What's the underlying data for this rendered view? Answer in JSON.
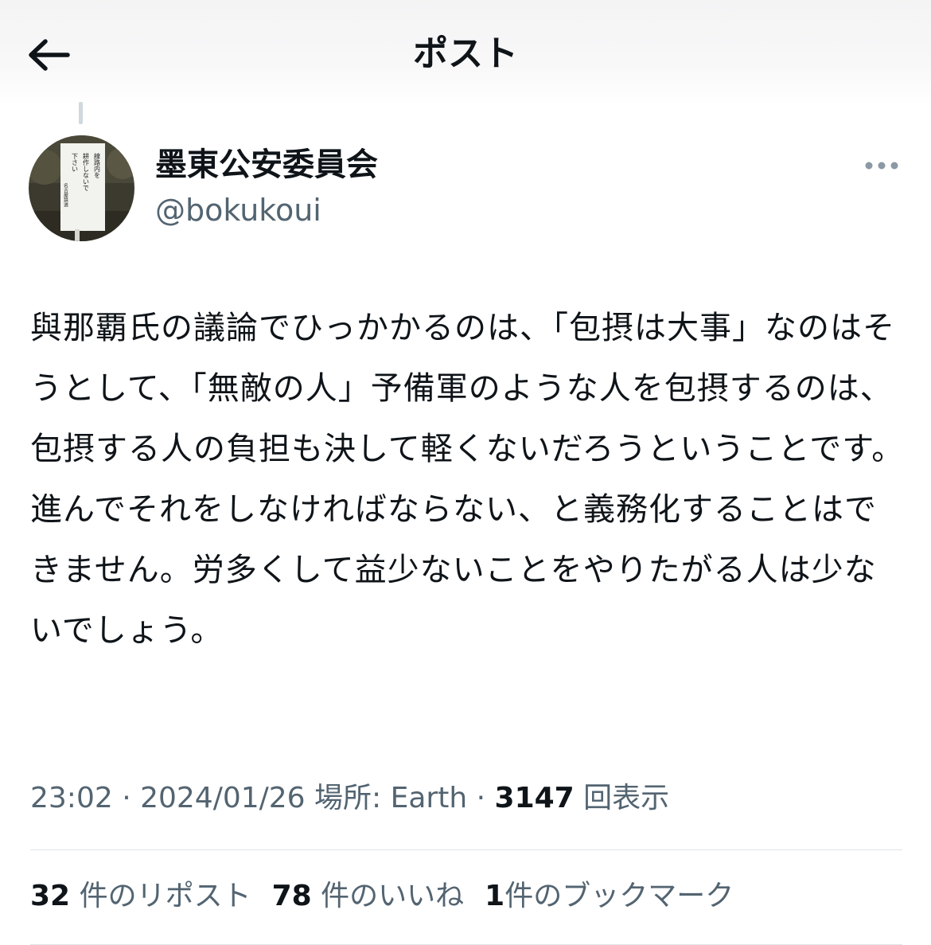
{
  "header": {
    "title": "ポスト",
    "back_icon": "arrow-left-icon"
  },
  "avatar": {
    "sign_text": [
      "線路内を",
      "耕作しないで",
      "下さい",
      "名古屋鉄道"
    ]
  },
  "author": {
    "display_name": "墨東公安委員会",
    "handle": "@bokukoui"
  },
  "tweet": {
    "text": "與那覇氏の議論でひっかかるのは、「包摂は大事」なのはそうとして、「無敵の人」予備軍のような人を包摂するのは、包摂する人の負担も決して軽くないだろうということです。進んでそれをしなければならない、と義務化することはできません。労多くして益少ないことをやりたがる人は少ないでしょう。"
  },
  "meta": {
    "time": "23:02",
    "sep1": " · ",
    "date": "2024/01/26",
    "location_label": "場所: Earth",
    "sep2": " · ",
    "views_count": "3147",
    "views_label": "回表示"
  },
  "stats": {
    "reposts_count": "32",
    "reposts_label": "件のリポスト",
    "likes_count": "78",
    "likes_label": "件のいいね",
    "bookmarks_count": "1",
    "bookmarks_label": "件のブックマーク"
  },
  "colors": {
    "text_primary": "#0f1419",
    "text_secondary": "#536471",
    "divider": "#e1e5e9"
  }
}
